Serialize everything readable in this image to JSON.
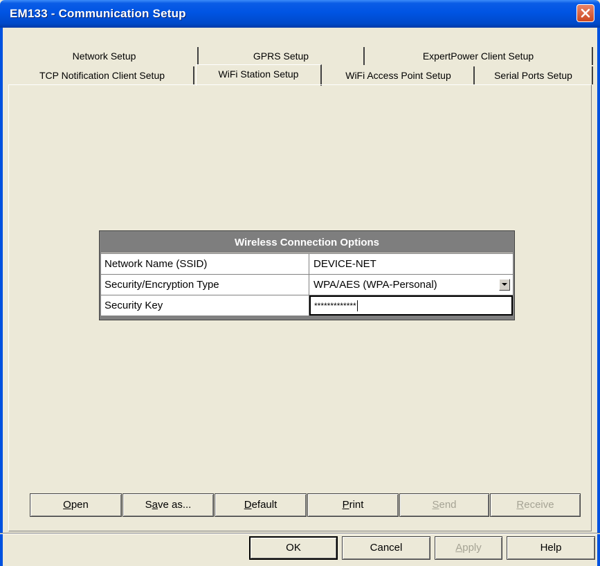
{
  "window": {
    "title": "EM133 - Communication Setup"
  },
  "tabs": {
    "row1": [
      {
        "label": "Network Setup"
      },
      {
        "label": "GPRS Setup"
      },
      {
        "label": "ExpertPower Client Setup"
      }
    ],
    "row2": [
      {
        "label": "TCP Notification Client Setup"
      },
      {
        "label": "WiFi Station Setup",
        "active": true
      },
      {
        "label": "WiFi Access Point Setup"
      },
      {
        "label": "Serial Ports Setup"
      }
    ]
  },
  "grid": {
    "header": "Wireless Connection Options",
    "rows": [
      {
        "label": "Network Name (SSID)",
        "value": "DEVICE-NET"
      },
      {
        "label": "Security/Encryption Type",
        "value": "WPA/AES (WPA-Personal)"
      },
      {
        "label": "Security Key",
        "value": "*************"
      }
    ]
  },
  "action_buttons": {
    "open": {
      "pre": "",
      "accel": "O",
      "post": "pen"
    },
    "save_as": {
      "pre": "S",
      "accel": "a",
      "post": "ve as..."
    },
    "default": {
      "pre": "",
      "accel": "D",
      "post": "efault"
    },
    "print": {
      "pre": "",
      "accel": "P",
      "post": "rint"
    },
    "send": {
      "pre": "",
      "accel": "S",
      "post": "end"
    },
    "receive": {
      "pre": "",
      "accel": "R",
      "post": "eceive"
    }
  },
  "dialog_buttons": {
    "ok": "OK",
    "cancel": "Cancel",
    "apply": {
      "pre": "",
      "accel": "A",
      "post": "pply"
    },
    "help": "Help"
  },
  "icons": {
    "close": "close-icon",
    "dropdown": "chevron-down-icon"
  },
  "colors": {
    "title_bar": "#0054e3",
    "dialog_bg": "#ece9d8",
    "grid_header": "#7e7e7e",
    "close_button": "#cc4820"
  }
}
